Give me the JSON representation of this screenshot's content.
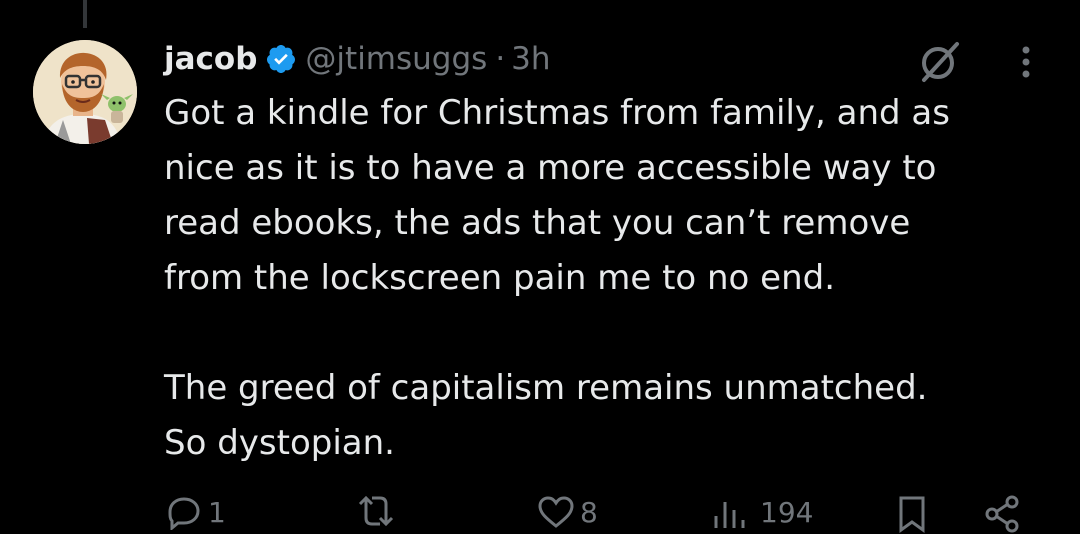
{
  "tweet": {
    "display_name": "jacob",
    "handle": "@jtimsuggs",
    "separator": "·",
    "time": "3h",
    "text": "Got a kindle for Christmas from family, and as\nnice as it is to have a more accessible way to\nread ebooks, the ads that you can’t remove\nfrom the lockscreen pain me to no end.\n\nThe greed of capitalism remains unmatched.\nSo dystopian."
  },
  "actions": {
    "reply_count": "1",
    "repost_count": "",
    "like_count": "8",
    "view_count": "194"
  },
  "icons": {
    "verified": "verified-badge-icon",
    "grok": "grok-icon",
    "more": "more-vertical-icon",
    "reply": "reply-icon",
    "repost": "repost-icon",
    "like": "heart-icon",
    "views": "views-icon",
    "bookmark": "bookmark-icon",
    "share": "share-icon"
  },
  "colors": {
    "background": "#000000",
    "text": "#e7e9ea",
    "secondary": "#71767b",
    "verified": "#1d9bf0",
    "thread_line": "#333639"
  }
}
